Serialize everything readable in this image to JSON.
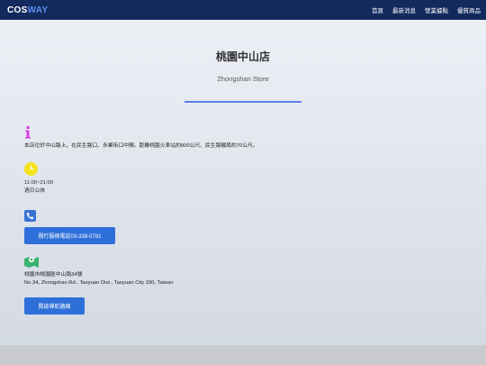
{
  "nav": {
    "brand_a": "COS",
    "brand_b": "WAY",
    "items": [
      "首頁",
      "最新消息",
      "營業據點",
      "優質商品"
    ]
  },
  "store": {
    "name": "桃園中山店",
    "name_en": "Zhongshan Store"
  },
  "info": {
    "description": "本店位於中山路上，在民生路口、永業街口中間。距離桃園火車站約800公尺、民生路戰局約70公尺。",
    "hours": "11:00~21:00",
    "closed": "週日公休",
    "call_label": "撥打服務電話03-338-0781",
    "address": "桃園市桃園區中山路34號",
    "address_en": "No.34, Zhongshan Rd., Taoyuan Dist., Taoyuan City 330, Taiwan",
    "nav_label": "開啟導航路線"
  },
  "colors": {
    "nav_bg": "#132a5e",
    "accent": "#5b8ff0",
    "button": "#2f6fd9",
    "info_icon": "#d63fe0",
    "clock_icon": "#f2e21b",
    "phone_icon": "#3a73d6",
    "map_icon": "#3cb371"
  },
  "icons": [
    "info-icon",
    "clock-icon",
    "phone-icon",
    "map-pin-icon"
  ]
}
